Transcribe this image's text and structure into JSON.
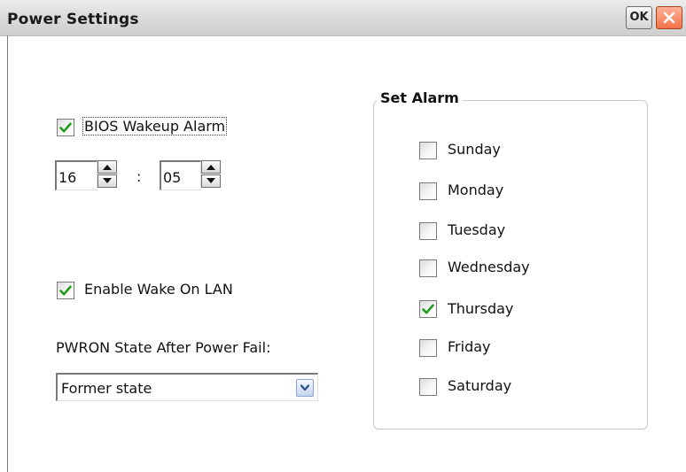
{
  "window": {
    "title": "Power Settings",
    "ok_label": "OK"
  },
  "bios_alarm": {
    "label": "BIOS Wakeup Alarm",
    "checked": true,
    "hour": "16",
    "separator": ":",
    "minute": "05"
  },
  "wake_on_lan": {
    "label": "Enable Wake On LAN",
    "checked": true
  },
  "pwron": {
    "label": "PWRON State After Power Fail:",
    "selected": "Former state"
  },
  "set_alarm": {
    "title": "Set Alarm",
    "days": [
      {
        "label": "Sunday",
        "checked": false
      },
      {
        "label": "Monday",
        "checked": false
      },
      {
        "label": "Tuesday",
        "checked": false
      },
      {
        "label": "Wednesday",
        "checked": false
      },
      {
        "label": "Thursday",
        "checked": true
      },
      {
        "label": "Friday",
        "checked": false
      },
      {
        "label": "Saturday",
        "checked": false
      }
    ]
  },
  "colors": {
    "check_mark": "#1f9a1f",
    "close_button": "#f37248",
    "titlebar": "#dcdcdc"
  }
}
